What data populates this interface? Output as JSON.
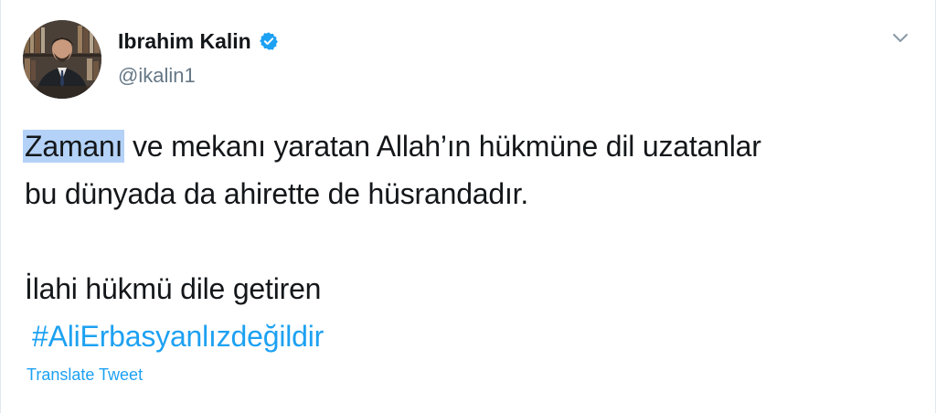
{
  "tweet": {
    "author": {
      "display_name": "Ibrahim Kalin",
      "handle": "@ikalin1",
      "verified": true
    },
    "text": {
      "highlighted_word": "Zamanı",
      "line1_rest": " ve mekanı yaratan Allah’ın hükmüne dil uzatanlar",
      "line2": "bu dünyada da ahirette de hüsrandadır.",
      "line3": "İlahi hükmü dile getiren",
      "hashtag": "#AliErbasyanlızdeğildir"
    },
    "translate_label": "Translate Tweet"
  },
  "icons": {
    "verified": "verified-badge-icon",
    "menu": "chevron-down-icon"
  },
  "colors": {
    "accent": "#1da1f2",
    "selection": "#b4d2f7",
    "secondary_text": "#657786"
  }
}
